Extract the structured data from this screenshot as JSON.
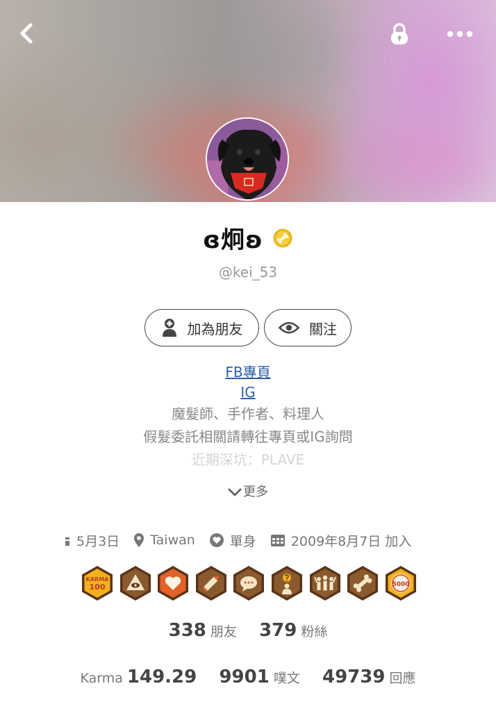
{
  "header": {
    "back_icon": "chevron-left-icon",
    "lock_icon": "lock-icon",
    "more_icon": "more-horizontal-icon"
  },
  "profile": {
    "display_name": "ɞ炯ʚ",
    "handle": "@kei_53",
    "badge_icon": "gold-bone-badge-icon",
    "badge_color": "#E8B21A"
  },
  "actions": {
    "add_friend_label": "加為朋友",
    "follow_label": "關注"
  },
  "bio": {
    "links": [
      "FB專頁",
      "IG"
    ],
    "lines": [
      "魔髮師、手作者、料理人",
      "假髮委託相關請轉往專頁或IG詢問",
      "近期深坑：PLAVE"
    ],
    "more_label": "更多",
    "link_color": "#2F5FA8"
  },
  "meta": {
    "birthday": "5月3日",
    "location": "Taiwan",
    "relationship": "單身",
    "joined": "2009年8月7日 加入"
  },
  "badges": [
    "karma-100",
    "eye-triangle",
    "heart",
    "pencil",
    "speech-bubble",
    "question-person",
    "group-people",
    "bone",
    "5000"
  ],
  "badge_texts": {
    "karma_title": "KARMA",
    "karma_value": "100",
    "coin_value": "5000"
  },
  "counts": {
    "friends_value": "338",
    "friends_label": "朋友",
    "fans_value": "379",
    "fans_label": "粉絲"
  },
  "stats": {
    "karma_label": "Karma",
    "karma_value": "149.29",
    "posts_value": "9901",
    "posts_label": "噗文",
    "replies_value": "49739",
    "replies_label": "回應"
  }
}
